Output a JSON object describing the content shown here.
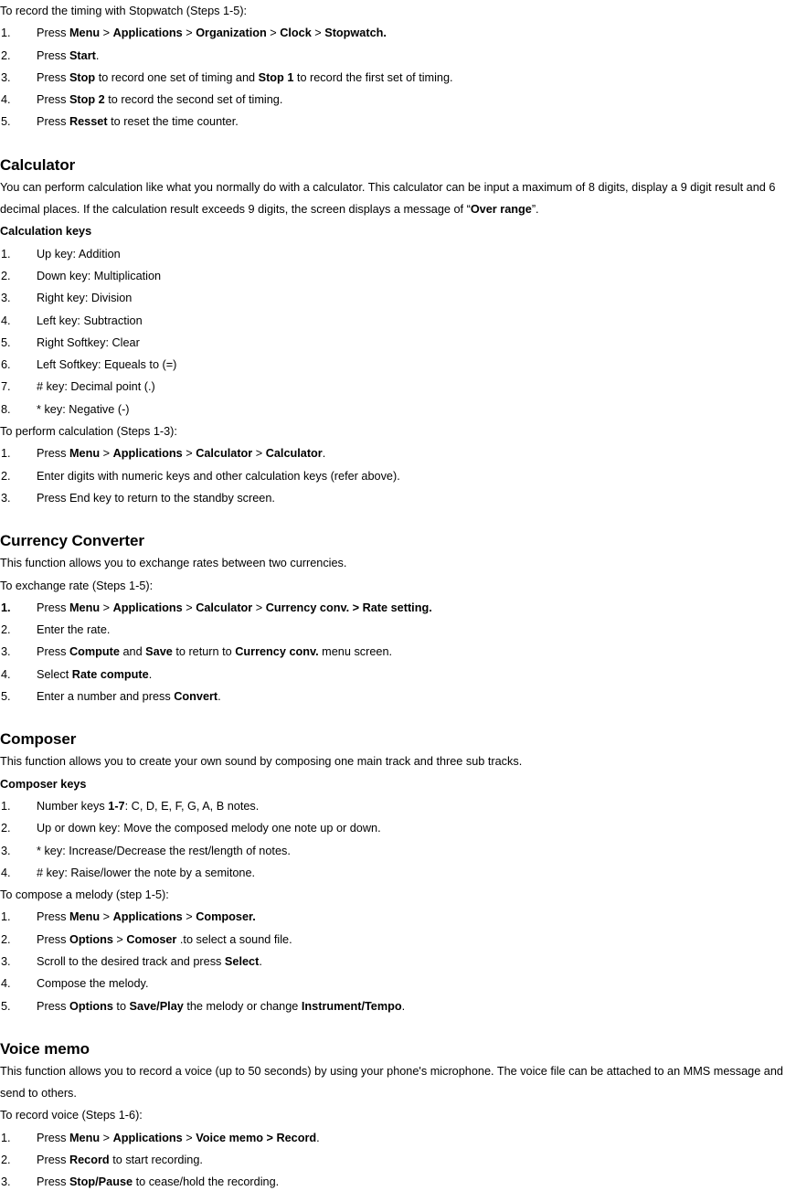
{
  "document": {
    "sections": [
      {
        "id": "stopwatch",
        "intro": "To record the timing with Stopwatch (Steps 1-5):",
        "steps": [
          {
            "num": "1.",
            "html": "Press <b>Menu</b> &gt; <b>Applications</b> &gt; <b>Organization</b> &gt; <b>Clock</b> &gt; <b>Stopwatch.</b>"
          },
          {
            "num": "2.",
            "html": "Press <b>Start</b>."
          },
          {
            "num": "3.",
            "html": "Press <b>Stop</b> to record one set of timing and <b>Stop 1</b> to record the first set of timing."
          },
          {
            "num": "4.",
            "html": "Press <b>Stop 2</b> to record the second set of timing."
          },
          {
            "num": "5.",
            "html": "Press <b>Resset</b> to reset the time counter."
          }
        ]
      },
      {
        "id": "calculator",
        "heading": "Calculator",
        "body": "You can perform calculation like what you normally do with a calculator. This calculator can be input a maximum of 8 digits, display a 9 digit result and 6 decimal places. If the calculation result exceeds 9 digits, the screen displays a message of “<b>Over range</b>”.",
        "subhead": "Calculation keys",
        "keys": [
          {
            "num": "1.",
            "html": "Up key: Addition"
          },
          {
            "num": "2.",
            "html": "Down key: Multiplication"
          },
          {
            "num": "3.",
            "html": "Right key: Division"
          },
          {
            "num": "4.",
            "html": "Left key: Subtraction"
          },
          {
            "num": "5.",
            "html": "Right Softkey: Clear"
          },
          {
            "num": "6.",
            "html": "Left Softkey: Equeals to (=)"
          },
          {
            "num": "7.",
            "html": "# key: Decimal point (.)"
          },
          {
            "num": "8.",
            "html": "* key: Negative (-)"
          }
        ],
        "procedure_intro": "To perform calculation (Steps 1-3):",
        "procedure": [
          {
            "num": "1.",
            "html": "Press <b>Menu</b> &gt; <b>Applications</b> &gt; <b>Calculator</b> &gt; <b>Calculator</b>."
          },
          {
            "num": "2.",
            "html": "Enter digits with numeric keys and other calculation keys (refer above)."
          },
          {
            "num": "3.",
            "html": "Press End key to return to the standby screen."
          }
        ]
      },
      {
        "id": "currency-converter",
        "heading": "Currency Converter",
        "body": "This function allows you to exchange rates between two currencies.",
        "procedure_intro": "To exchange rate (Steps 1-5):",
        "procedure": [
          {
            "num": "1.",
            "num_bold": true,
            "html": "Press <b>Menu</b> &gt; <b>Applications</b> &gt; <b>Calculator</b> &gt; <b>Currency conv. &gt; Rate setting.</b>"
          },
          {
            "num": "2.",
            "html": "Enter the rate."
          },
          {
            "num": "3.",
            "html": "Press <b>Compute</b> and <b>Save</b> to return to <b>Currency conv.</b> menu screen."
          },
          {
            "num": "4.",
            "html": "Select <b>Rate compute</b>."
          },
          {
            "num": "5.",
            "html": "Enter a number and press <b>Convert</b>."
          }
        ]
      },
      {
        "id": "composer",
        "heading": "Composer",
        "body": "This function allows you to create your own sound by composing one main track and three sub tracks.",
        "subhead": "Composer keys",
        "keys": [
          {
            "num": "1.",
            "html": "Number keys <b>1-7</b>: C, D, E, F, G, A, B notes."
          },
          {
            "num": "2.",
            "html": "Up or down key: Move the composed melody one note up or down."
          },
          {
            "num": "3.",
            "html": "* key: Increase/Decrease the rest/length of notes."
          },
          {
            "num": "4.",
            "html": "# key: Raise/lower the note by a semitone."
          }
        ],
        "procedure_intro": "To compose a melody (step 1-5):",
        "procedure": [
          {
            "num": "1.",
            "html": "Press <b>Menu</b> &gt; <b>Applications</b> &gt; <b>Composer.</b>"
          },
          {
            "num": "2.",
            "html": "Press <b>Options</b> &gt; <b>Comoser</b> .to select a sound file."
          },
          {
            "num": "3.",
            "html": "Scroll to the desired track and press <b>Select</b>."
          },
          {
            "num": "4.",
            "html": "Compose the melody."
          },
          {
            "num": "5.",
            "html": "Press <b>Options</b> to <b>Save/Play</b> the melody or change <b>Instrument/Tempo</b>."
          }
        ]
      },
      {
        "id": "voice-memo",
        "heading": "Voice memo",
        "body": "This function allows you to record a voice (up to 50 seconds) by using your phone's microphone. The voice file can be attached to an MMS message and send to others.",
        "procedure_intro": "To record voice (Steps 1-6):",
        "procedure": [
          {
            "num": "1.",
            "html": "Press <b>Menu</b> &gt; <b>Applications</b> &gt; <b>Voice memo &gt; Record</b>."
          },
          {
            "num": "2.",
            "html": "Press <b>Record</b> to start recording."
          },
          {
            "num": "3.",
            "html": "Press <b>Stop/Pause</b> to cease/hold the recording."
          }
        ]
      }
    ]
  }
}
